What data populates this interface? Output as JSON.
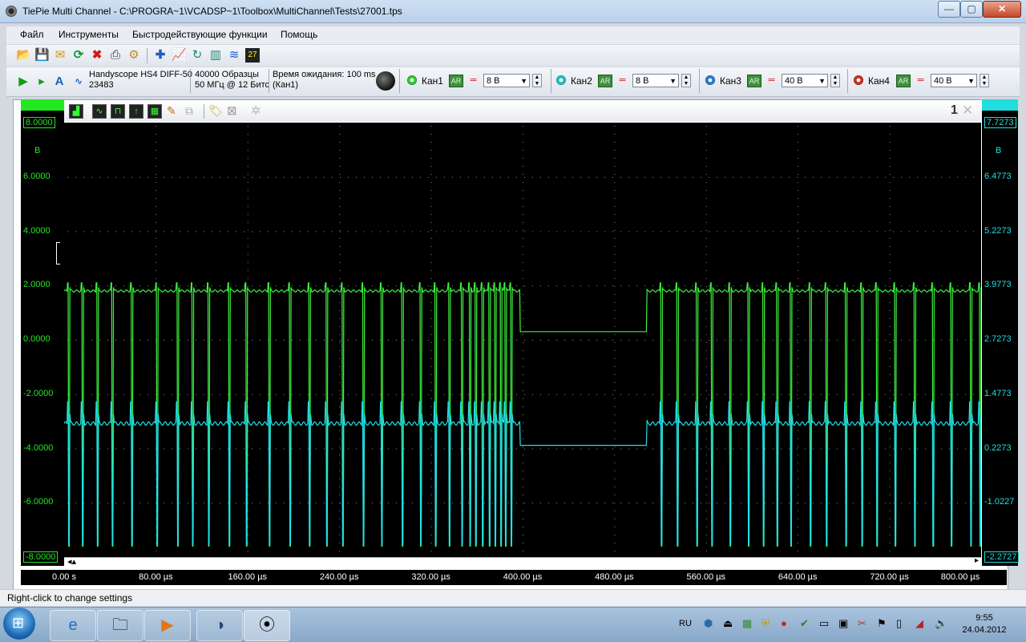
{
  "window": {
    "title": "TiePie Multi Channel - C:\\PROGRA~1\\VCADSP~1\\Toolbox\\MultiChannel\\Tests\\27001.tps",
    "controls": {
      "minimize": "—",
      "maximize": "▢",
      "close": "✕"
    }
  },
  "menu": [
    "Файл",
    "Инструменты",
    "Быстродействующие функции",
    "Помощь"
  ],
  "instrument": {
    "name": "Handyscope HS4 DIFF-50",
    "serial": "23483",
    "samples": "40000 Образцы",
    "rate": "50 МГц @ 12 Битс",
    "wait_label": "Время ожидания: 100 ms",
    "wait_channel": "(Кан1)"
  },
  "channels": [
    {
      "label": "Кан1",
      "ar": "AR",
      "range": "8 В",
      "color": "#2ec82e"
    },
    {
      "label": "Кан2",
      "ar": "AR",
      "range": "8 В",
      "color": "#1fc0c0"
    },
    {
      "label": "Кан3",
      "ar": "AR",
      "range": "40 В",
      "color": "#2a7ad0"
    },
    {
      "label": "Кан4",
      "ar": "AR",
      "range": "40 В",
      "color": "#d03020"
    }
  ],
  "scope": {
    "window_number": "1",
    "left_axis": {
      "unit": "В",
      "ticks": [
        "8.0000",
        "6.0000",
        "4.0000",
        "2.0000",
        "0.0000",
        "-2.0000",
        "-4.0000",
        "-6.0000",
        "-8.0000"
      ],
      "color": "#22e822"
    },
    "right_axis": {
      "unit": "В",
      "ticks": [
        "7.7273",
        "6.4773",
        "5.2273",
        "3.9773",
        "2.7273",
        "1.4773",
        "0.2273",
        "-1.0227",
        "-2.2727"
      ],
      "color": "#22dddd"
    },
    "x_ticks": [
      "0.00 s",
      "80.00 µs",
      "160.00 µs",
      "240.00 µs",
      "320.00 µs",
      "400.00 µs",
      "480.00 µs",
      "560.00 µs",
      "640.00 µs",
      "720.00 µs",
      "800.00 µs"
    ]
  },
  "chart_data": {
    "type": "line",
    "x_range_us": [
      0,
      800
    ],
    "x_unit": "µs",
    "ylim_left": [
      -8,
      8
    ],
    "ylim_right": [
      -2.2727,
      7.7273
    ],
    "grid": true,
    "series": [
      {
        "name": "Кан1",
        "color": "#3ef03e",
        "y_axis": "left",
        "high": 1.8,
        "low": 0.3,
        "peak": 2.1,
        "trough": -7.6,
        "pulse_times_us": [
          3,
          15,
          28,
          41,
          58,
          80,
          98,
          111,
          125,
          143,
          158,
          178,
          196,
          213,
          228,
          242,
          260,
          276,
          294,
          310,
          323,
          335,
          346,
          353,
          358,
          364,
          370,
          375,
          380,
          384,
          389,
          398,
          410,
          426,
          441,
          456,
          471,
          483,
          496,
          506,
          520,
          534,
          551,
          564,
          580,
          596,
          609,
          621,
          633,
          650,
          664,
          681,
          695,
          708,
          724,
          741,
          757,
          773,
          790,
          798
        ]
      },
      {
        "name": "Кан2",
        "color": "#22e0e8",
        "y_axis": "right",
        "high": 0.8,
        "low": 0.3,
        "peak": 1.3,
        "trough": -2.0
      }
    ],
    "idle_interval_us": [
      398,
      508
    ],
    "idle_levels": {
      "Кан1": 0.3,
      "Кан2": 0.3
    }
  },
  "status": {
    "text": "Right-click to change settings"
  },
  "taskbar": {
    "apps": [
      "internet-explorer",
      "explorer",
      "media-player",
      "vcads",
      "tiepie"
    ],
    "lang": "RU",
    "time": "9:55",
    "date": "24.04.2012"
  }
}
